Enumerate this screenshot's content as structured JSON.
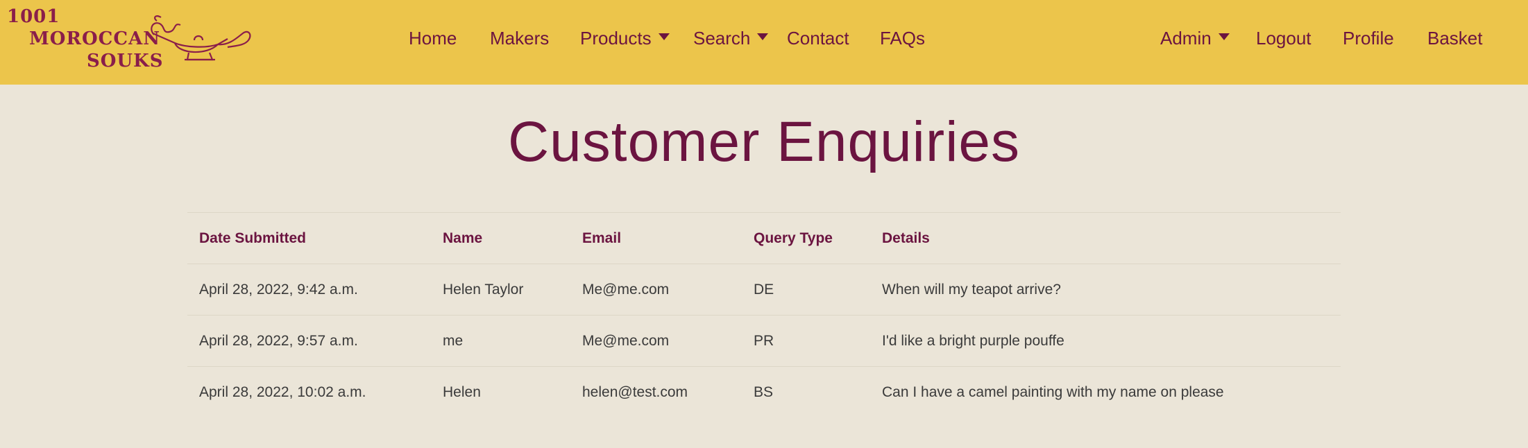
{
  "brand": {
    "line1": "1001",
    "line2": "MOROCCAN",
    "line3": "SOUKS"
  },
  "nav": {
    "home": "Home",
    "makers": "Makers",
    "products": "Products",
    "search": "Search",
    "contact": "Contact",
    "faqs": "FAQs",
    "admin": "Admin",
    "logout": "Logout",
    "profile": "Profile",
    "basket": "Basket"
  },
  "page": {
    "title": "Customer Enquiries"
  },
  "table": {
    "headers": [
      "Date Submitted",
      "Name",
      "Email",
      "Query Type",
      "Details"
    ],
    "rows": [
      [
        "April 28, 2022, 9:42 a.m.",
        "Helen Taylor",
        "Me@me.com",
        "DE",
        "When will my teapot arrive?"
      ],
      [
        "April 28, 2022, 9:57 a.m.",
        "me",
        "Me@me.com",
        "PR",
        "I'd like a bright purple pouffe"
      ],
      [
        "April 28, 2022, 10:02 a.m.",
        "Helen",
        "helen@test.com",
        "BS",
        "Can I have a camel painting with my name on please"
      ]
    ]
  },
  "colors": {
    "navbar": "#ecc54b",
    "background": "#ebe5d8",
    "accent": "#6b1440"
  }
}
